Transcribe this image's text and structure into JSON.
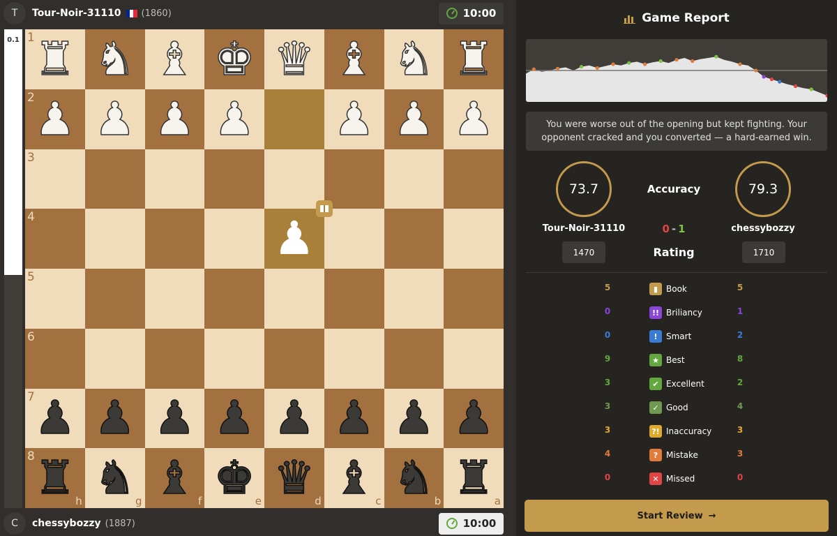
{
  "top_player": {
    "initial": "T",
    "name": "Tour-Noir-31110",
    "rating": "(1860)",
    "clock": "10:00",
    "flag_colors": [
      "#002395",
      "#ffffff",
      "#ed2939"
    ]
  },
  "bottom_player": {
    "initial": "C",
    "name": "chessybozzy",
    "rating": "(1887)",
    "clock": "10:00"
  },
  "eval": {
    "text": "0.1",
    "white_share": 0.513
  },
  "board": {
    "ranks": [
      "1",
      "2",
      "3",
      "4",
      "5",
      "6",
      "7",
      "8"
    ],
    "files": [
      "h",
      "g",
      "f",
      "e",
      "d",
      "c",
      "b",
      "a"
    ],
    "rows": [
      [
        "♜",
        "♞",
        "♝",
        "♚",
        "♛",
        "♝",
        "♞",
        "♜"
      ],
      [
        "♟",
        "♟",
        "♟",
        "♟",
        "",
        "♟",
        "♟",
        "♟"
      ],
      [
        "",
        "",
        "",
        "",
        "",
        "",
        "",
        ""
      ],
      [
        "",
        "",
        "",
        "",
        "♟",
        "",
        "",
        ""
      ],
      [
        "",
        "",
        "",
        "",
        "",
        "",
        "",
        ""
      ],
      [
        "",
        "",
        "",
        "",
        "",
        "",
        "",
        ""
      ],
      [
        "♟",
        "♟",
        "♟",
        "♟",
        "♟",
        "♟",
        "♟",
        "♟"
      ],
      [
        "♜",
        "♞",
        "♝",
        "♚",
        "♛",
        "♝",
        "♞",
        "♜"
      ]
    ],
    "colors": [
      "w",
      "w",
      "",
      "",
      "",
      "",
      "b",
      "b"
    ],
    "book_icon": "book-icon",
    "highlight_squares": [
      [
        1,
        4
      ],
      [
        3,
        4
      ]
    ]
  },
  "report": {
    "title": "Game Report",
    "icon": "bar-chart-icon",
    "summary": "You were worse out of the opening but kept fighting. Your opponent cracked and you converted — a hard-earned win.",
    "accuracy_label": "Accuracy",
    "rating_label": "Rating",
    "left": {
      "name": "Tour-Noir-31110",
      "accuracy": "73.7",
      "rating": "1470"
    },
    "right": {
      "name": "chessybozzy",
      "accuracy": "79.3",
      "rating": "1710"
    },
    "score": {
      "left": "0",
      "dash": "-",
      "right": "1"
    },
    "accent": "#c49a4c"
  },
  "graph": {
    "eval_series": [
      0.55,
      0.48,
      0.52,
      0.5,
      0.47,
      0.45,
      0.5,
      0.44,
      0.42,
      0.46,
      0.43,
      0.4,
      0.42,
      0.38,
      0.36,
      0.4,
      0.37,
      0.35,
      0.38,
      0.33,
      0.3,
      0.35,
      0.32,
      0.3,
      0.28,
      0.33,
      0.36,
      0.4,
      0.42,
      0.5,
      0.6,
      0.64,
      0.68,
      0.72,
      0.75,
      0.78,
      0.8,
      0.85,
      0.9
    ],
    "dots": [
      {
        "i": 1,
        "c": "#e07b39"
      },
      {
        "i": 4,
        "c": "#e07b39"
      },
      {
        "i": 7,
        "c": "#7cc243"
      },
      {
        "i": 9,
        "c": "#e07b39"
      },
      {
        "i": 11,
        "c": "#e07b39"
      },
      {
        "i": 13,
        "c": "#7cc243"
      },
      {
        "i": 15,
        "c": "#e07b39"
      },
      {
        "i": 17,
        "c": "#7cc243"
      },
      {
        "i": 19,
        "c": "#e07b39"
      },
      {
        "i": 21,
        "c": "#e07b39"
      },
      {
        "i": 24,
        "c": "#7cc243"
      },
      {
        "i": 27,
        "c": "#e07b39"
      },
      {
        "i": 29,
        "c": "#e07b39"
      },
      {
        "i": 30,
        "c": "#8a46d6"
      },
      {
        "i": 31,
        "c": "#e04444"
      },
      {
        "i": 32,
        "c": "#3a7bd5"
      },
      {
        "i": 34,
        "c": "#e04444"
      },
      {
        "i": 36,
        "c": "#7cc243"
      },
      {
        "i": 38,
        "c": "#e04444"
      }
    ]
  },
  "classifications": [
    {
      "name": "Book",
      "left": "5",
      "right": "5",
      "icon": "book-icon",
      "symbol": "▮",
      "color": "#c49a4c"
    },
    {
      "name": "Briliancy",
      "left": "0",
      "right": "1",
      "icon": "brilliant-icon",
      "symbol": "!!",
      "color": "#8a46d6"
    },
    {
      "name": "Smart",
      "left": "0",
      "right": "2",
      "icon": "smart-icon",
      "symbol": "!",
      "color": "#3a7bd5"
    },
    {
      "name": "Best",
      "left": "9",
      "right": "8",
      "icon": "star-icon",
      "symbol": "★",
      "color": "#62a83e"
    },
    {
      "name": "Excellent",
      "left": "3",
      "right": "2",
      "icon": "double-check-icon",
      "symbol": "✔",
      "color": "#62a83e"
    },
    {
      "name": "Good",
      "left": "3",
      "right": "4",
      "icon": "check-icon",
      "symbol": "✓",
      "color": "#6e9a4f"
    },
    {
      "name": "Inaccuracy",
      "left": "3",
      "right": "3",
      "icon": "inaccuracy-icon",
      "symbol": "?!",
      "color": "#e0a92a"
    },
    {
      "name": "Mistake",
      "left": "4",
      "right": "3",
      "icon": "mistake-icon",
      "symbol": "?",
      "color": "#e07b39"
    },
    {
      "name": "Missed",
      "left": "0",
      "right": "0",
      "icon": "missed-icon",
      "symbol": "✕",
      "color": "#e04444"
    }
  ],
  "start_button": {
    "label": "Start Review",
    "icon": "arrow-right-icon"
  }
}
